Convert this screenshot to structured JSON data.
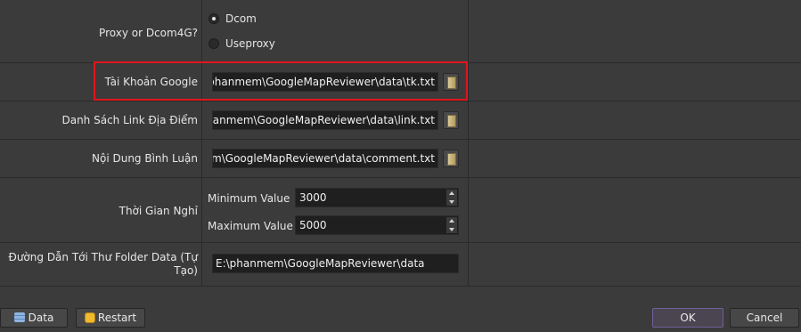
{
  "settings": {
    "proxy": {
      "label": "Proxy or Dcom4G?",
      "options": [
        "Dcom",
        "Useproxy"
      ],
      "selected": "Dcom"
    },
    "google_account": {
      "label": "Tài Khoản Google",
      "value": "E:\\phanmem\\GoogleMapReviewer\\data\\tk.txt"
    },
    "location_links": {
      "label": "Danh Sách Link Địa Điểm",
      "value": "E:\\phanmem\\GoogleMapReviewer\\data\\link.txt"
    },
    "comment_content": {
      "label": "Nội Dung Bình Luận",
      "value": "E:\\phanmem\\GoogleMapReviewer\\data\\comment.txt"
    },
    "rest_time": {
      "label": "Thời Gian Nghỉ",
      "min_label": "Minimum Value",
      "min_value": "3000",
      "max_label": "Maximum Value",
      "max_value": "5000"
    },
    "data_folder": {
      "label_line1": "Đường Dẫn Tới Thư Folder Data (Tự",
      "label_line2": "Tạo)",
      "value": "E:\\phanmem\\GoogleMapReviewer\\data"
    }
  },
  "footer": {
    "data_button": "Data",
    "restart_button": "Restart",
    "ok_button": "OK",
    "cancel_button": "Cancel"
  },
  "colors": {
    "background": "#3b3b3b",
    "highlight": "#e1161c",
    "ok_border": "#6f5f9a"
  }
}
